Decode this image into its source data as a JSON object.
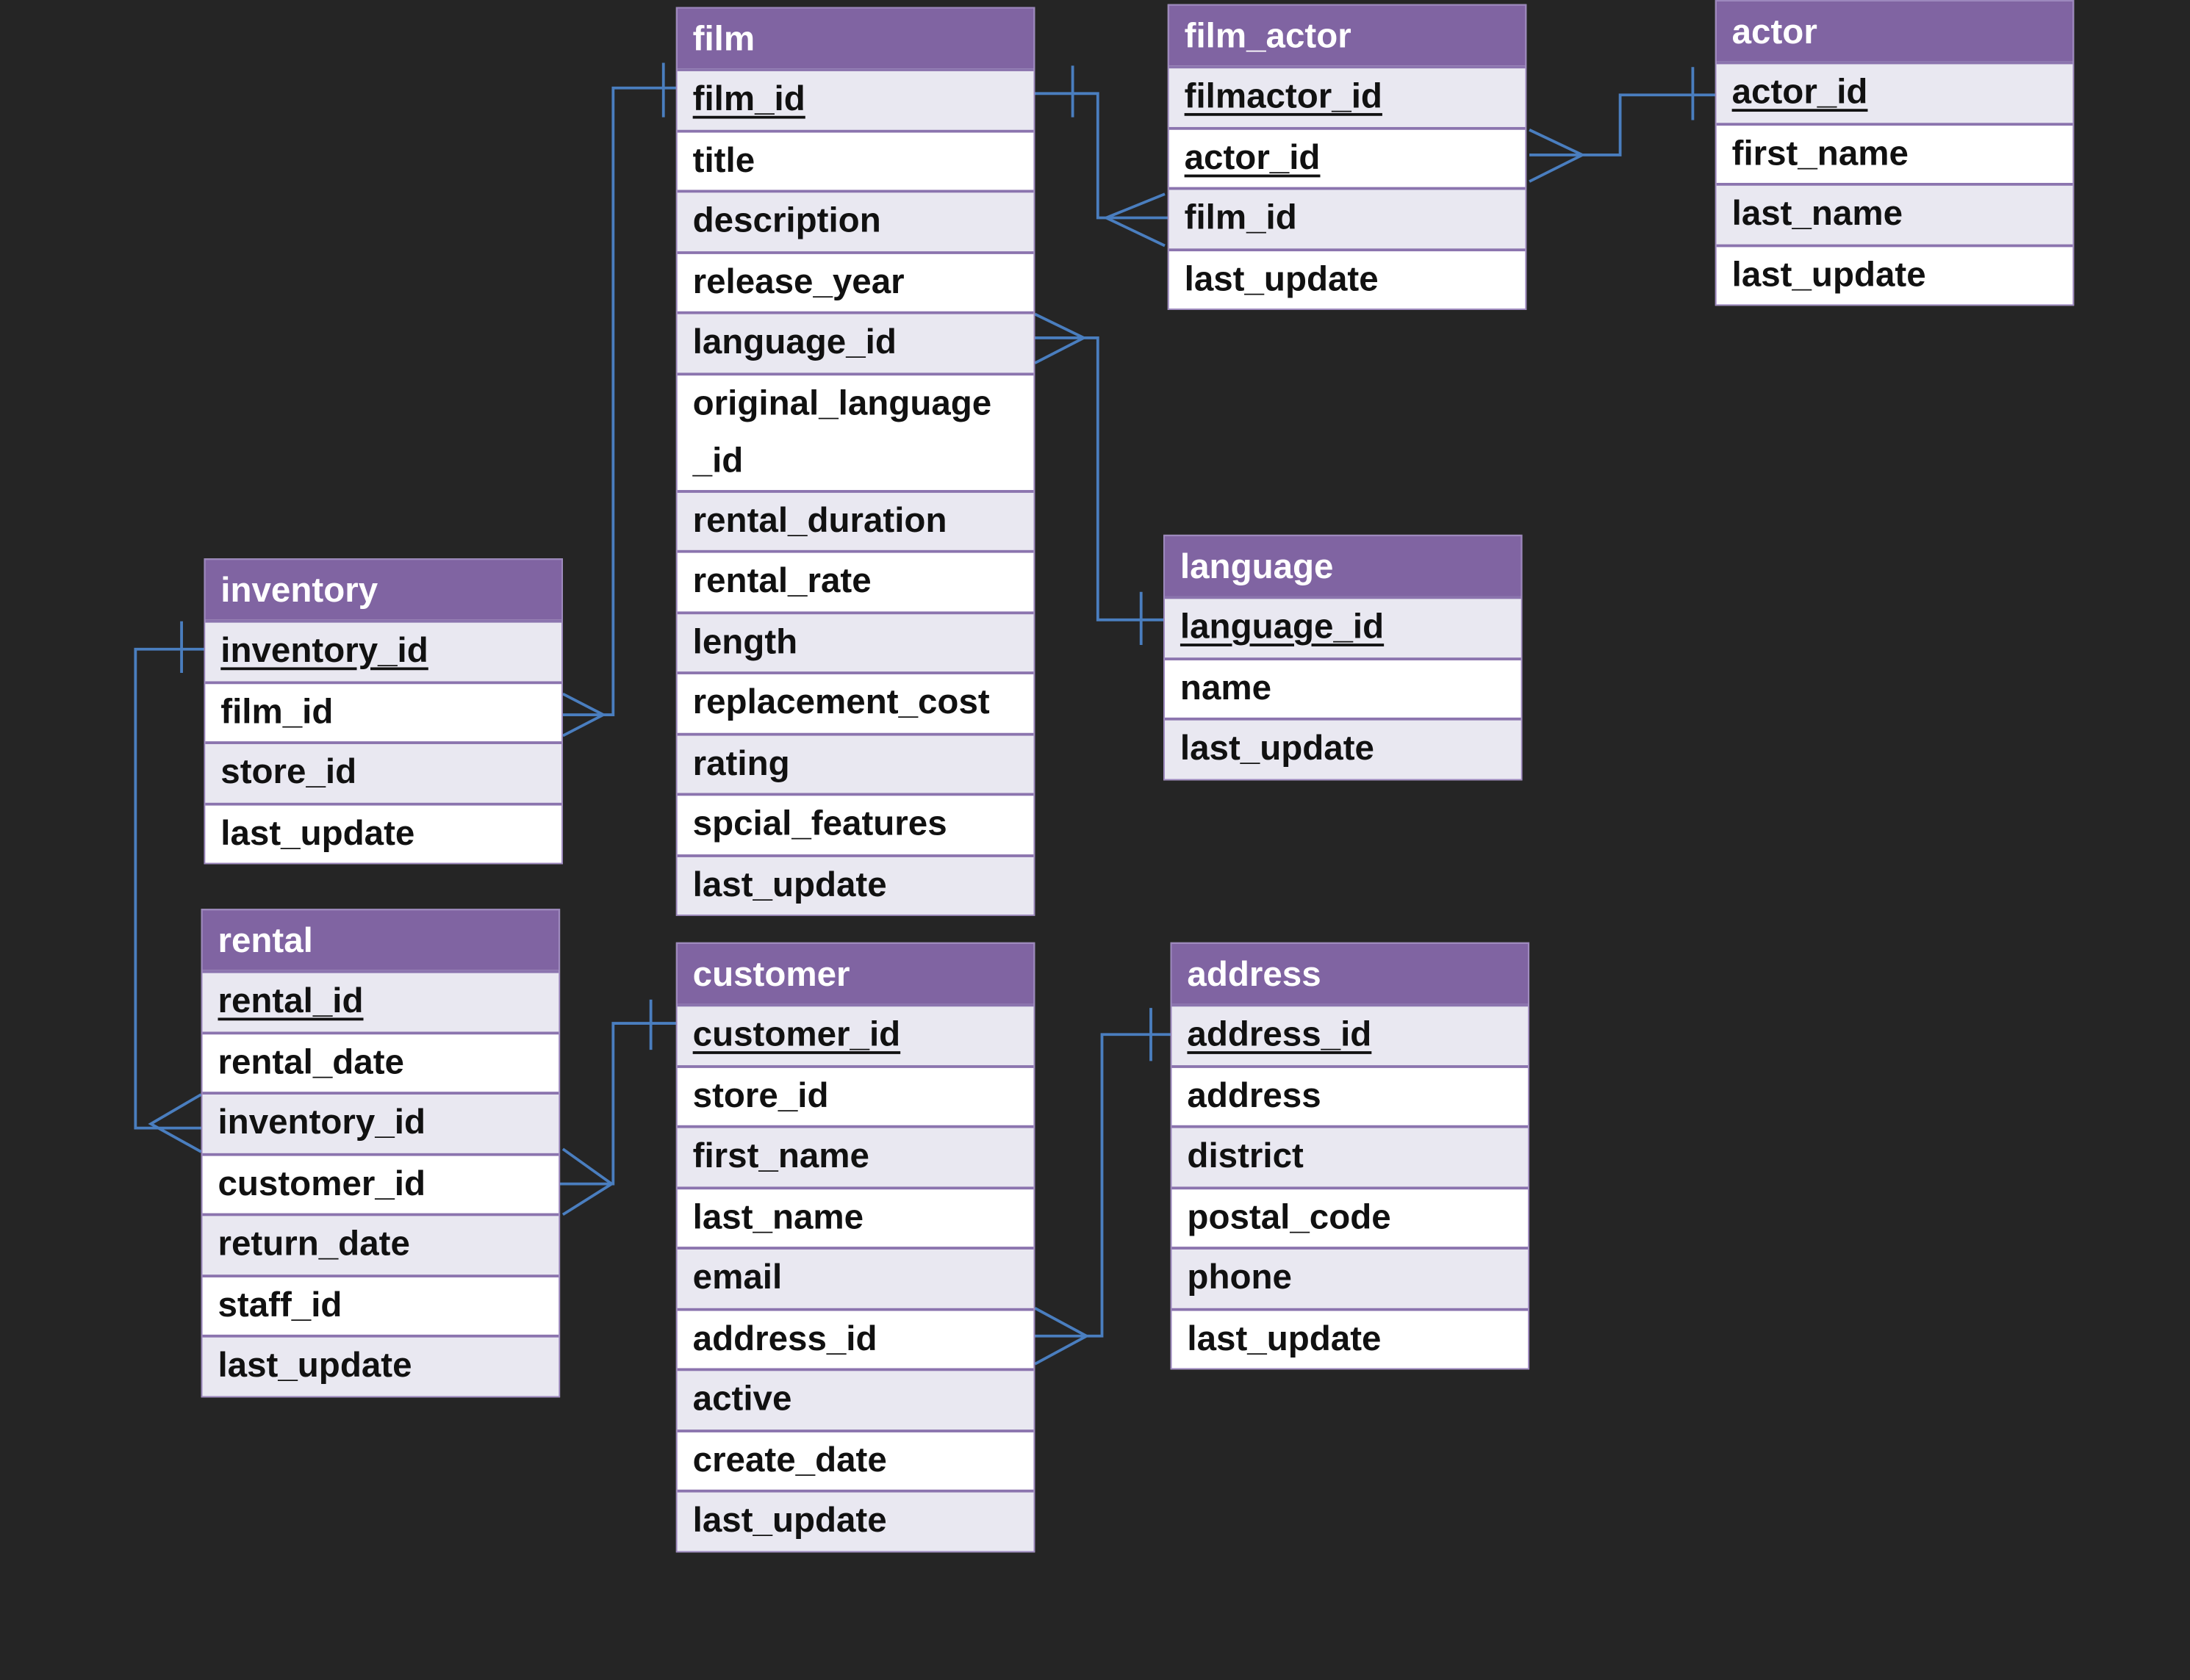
{
  "colors": {
    "background": "#252525",
    "header": "#8064a2",
    "row_alt": "#e9e8f1",
    "row": "#ffffff",
    "connector": "#4a7ebf"
  },
  "tables": [
    {
      "name": "film",
      "fields": [
        {
          "name": "film_id",
          "pk": true
        },
        {
          "name": "title"
        },
        {
          "name": "description"
        },
        {
          "name": "release_year"
        },
        {
          "name": "language_id"
        },
        {
          "name": "original_language _id"
        },
        {
          "name": "rental_duration"
        },
        {
          "name": "rental_rate"
        },
        {
          "name": "length"
        },
        {
          "name": "replacement_cost"
        },
        {
          "name": "rating"
        },
        {
          "name": "spcial_features"
        },
        {
          "name": "last_update"
        }
      ]
    },
    {
      "name": "film_actor",
      "fields": [
        {
          "name": "filmactor_id",
          "pk": true
        },
        {
          "name": "actor_id",
          "pk": true
        },
        {
          "name": "film_id"
        },
        {
          "name": "last_update"
        }
      ]
    },
    {
      "name": "actor",
      "fields": [
        {
          "name": "actor_id",
          "pk": true
        },
        {
          "name": "first_name"
        },
        {
          "name": "last_name"
        },
        {
          "name": "last_update"
        }
      ]
    },
    {
      "name": "language",
      "fields": [
        {
          "name": "language_id",
          "pk": true
        },
        {
          "name": "name"
        },
        {
          "name": "last_update"
        }
      ]
    },
    {
      "name": "inventory",
      "fields": [
        {
          "name": "inventory_id",
          "pk": true
        },
        {
          "name": "film_id"
        },
        {
          "name": "store_id"
        },
        {
          "name": "last_update"
        }
      ]
    },
    {
      "name": "rental",
      "fields": [
        {
          "name": "rental_id",
          "pk": true
        },
        {
          "name": "rental_date"
        },
        {
          "name": "inventory_id"
        },
        {
          "name": "customer_id"
        },
        {
          "name": "return_date"
        },
        {
          "name": "staff_id"
        },
        {
          "name": "last_update"
        }
      ]
    },
    {
      "name": "customer",
      "fields": [
        {
          "name": "customer_id",
          "pk": true
        },
        {
          "name": "store_id"
        },
        {
          "name": "first_name"
        },
        {
          "name": "last_name"
        },
        {
          "name": "email"
        },
        {
          "name": "address_id"
        },
        {
          "name": "active"
        },
        {
          "name": "create_date"
        },
        {
          "name": "last_update"
        }
      ]
    },
    {
      "name": "address",
      "fields": [
        {
          "name": "address_id",
          "pk": true
        },
        {
          "name": "address"
        },
        {
          "name": "district"
        },
        {
          "name": "postal_code"
        },
        {
          "name": "phone"
        },
        {
          "name": "last_update"
        }
      ]
    }
  ],
  "relationships": [
    {
      "from": "film.film_id",
      "to": "film_actor.film_id",
      "cardinality": "one-to-many"
    },
    {
      "from": "actor.actor_id",
      "to": "film_actor.actor_id",
      "cardinality": "one-to-many"
    },
    {
      "from": "language.language_id",
      "to": "film.language_id",
      "cardinality": "one-to-many"
    },
    {
      "from": "film.film_id",
      "to": "inventory.film_id",
      "cardinality": "one-to-many"
    },
    {
      "from": "inventory.inventory_id",
      "to": "rental.inventory_id",
      "cardinality": "one-to-many"
    },
    {
      "from": "customer.customer_id",
      "to": "rental.customer_id",
      "cardinality": "one-to-many"
    },
    {
      "from": "address.address_id",
      "to": "customer.address_id",
      "cardinality": "one-to-many"
    }
  ]
}
